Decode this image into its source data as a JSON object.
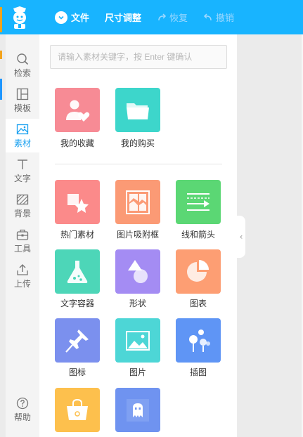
{
  "topbar": {
    "file_label": "文件",
    "resize_label": "尺寸调整",
    "redo_label": "恢复",
    "undo_label": "撤销"
  },
  "sidebar": {
    "items": [
      {
        "label": "检索",
        "icon": "search-icon"
      },
      {
        "label": "模板",
        "icon": "template-icon"
      },
      {
        "label": "素材",
        "icon": "image-icon",
        "active": true
      },
      {
        "label": "文字",
        "icon": "text-icon"
      },
      {
        "label": "背景",
        "icon": "background-icon"
      },
      {
        "label": "工具",
        "icon": "toolbox-icon"
      },
      {
        "label": "上传",
        "icon": "upload-icon"
      }
    ],
    "help_label": "帮助"
  },
  "search": {
    "placeholder": "请输入素材关键字，按 Enter 键确认"
  },
  "favorites": [
    {
      "label": "我的收藏",
      "icon": "favorite-user-icon",
      "color": "#f78b95"
    },
    {
      "label": "我的购买",
      "icon": "folder-icon",
      "color": "#3dd6cb"
    }
  ],
  "categories": [
    {
      "label": "热门素材",
      "icon": "star-shapes-icon",
      "color": "#fb8a8a"
    },
    {
      "label": "图片吸附框",
      "icon": "frame-icon",
      "color": "#fb9a75"
    },
    {
      "label": "线和箭头",
      "icon": "lines-arrow-icon",
      "color": "#5bd774"
    },
    {
      "label": "文字容器",
      "icon": "flask-icon",
      "color": "#4dd6b8"
    },
    {
      "label": "形状",
      "icon": "shapes-icon",
      "color": "#a48cf3"
    },
    {
      "label": "图表",
      "icon": "pie-chart-icon",
      "color": "#fd9e73"
    },
    {
      "label": "图标",
      "icon": "pin-icon",
      "color": "#7b90ee"
    },
    {
      "label": "图片",
      "icon": "picture-icon",
      "color": "#4dd6d6"
    },
    {
      "label": "插图",
      "icon": "illustration-tree-icon",
      "color": "#5f95f5"
    },
    {
      "label": "",
      "icon": "bag-icon",
      "color": "#fdc04d"
    },
    {
      "label": "",
      "icon": "pixel-ghost-icon",
      "color": "#6f93f0"
    }
  ],
  "colors": {
    "topbar": "#18b4ff",
    "active_nav": "#18a0f0"
  }
}
